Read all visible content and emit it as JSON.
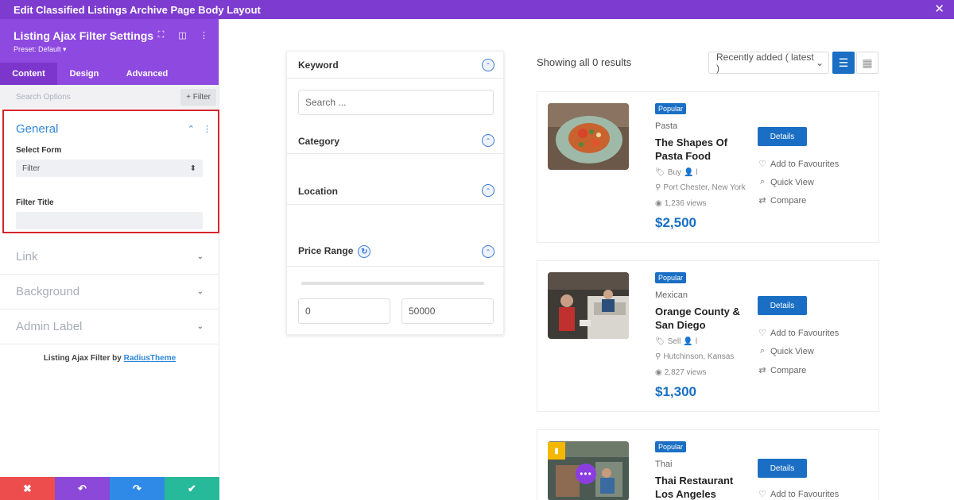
{
  "topbar": {
    "title": "Edit Classified Listings Archive Page Body Layout",
    "close_icon": "✕"
  },
  "panel": {
    "title": "Listing Ajax Filter Settings",
    "preset": "Preset: Default ▾",
    "tabs": [
      "Content",
      "Design",
      "Advanced"
    ],
    "search_placeholder": "Search Options",
    "filter_button": "+ Filter",
    "general": {
      "title": "General",
      "select_form_label": "Select Form",
      "select_form_value": "Filter",
      "filter_title_label": "Filter Title",
      "filter_title_value": ""
    },
    "accordions": [
      "Link",
      "Background",
      "Admin Label"
    ],
    "credit_prefix": "Listing Ajax Filter by",
    "credit_link": "RadiusTheme"
  },
  "filter": {
    "keyword_label": "Keyword",
    "keyword_placeholder": "Search ...",
    "category_label": "Category",
    "location_label": "Location",
    "price_label": "Price Range",
    "price_min": "0",
    "price_max": "50000"
  },
  "results": {
    "summary": "Showing all 0 results",
    "sort_value": "Recently added ( latest )"
  },
  "listings": [
    {
      "badge": "Popular",
      "category": "Pasta",
      "title": "The Shapes Of Pasta Food",
      "type": "Buy",
      "user": "l",
      "location": "Port Chester, New York",
      "views": "1,236 views",
      "price": "$2,500",
      "details": "Details",
      "fav": "Add to Favourites",
      "quick": "Quick View",
      "compare": "Compare"
    },
    {
      "badge": "Popular",
      "category": "Mexican",
      "title": "Orange County & San Diego",
      "type": "Sell",
      "user": "l",
      "location": "Hutchinson, Kansas",
      "views": "2,827 views",
      "price": "$1,300",
      "details": "Details",
      "fav": "Add to Favourites",
      "quick": "Quick View",
      "compare": "Compare"
    },
    {
      "badge": "Popular",
      "category": "Thai",
      "title": "Thai Restaurant Los Angeles",
      "details": "Details",
      "fav": "Add to Favourites"
    }
  ]
}
